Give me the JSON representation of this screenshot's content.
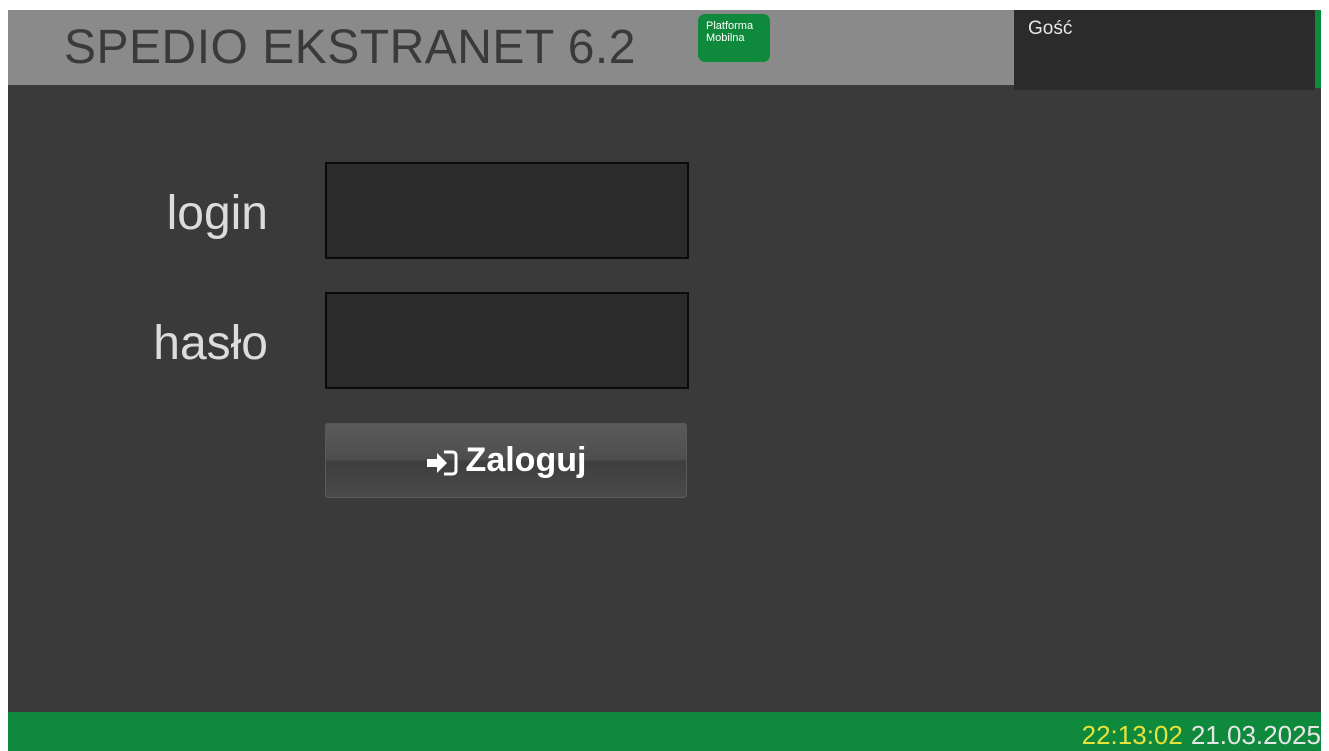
{
  "header": {
    "title": "SPEDIO EKSTRANET 6.2",
    "badge_line1": "Platforma",
    "badge_line2": "Mobilna",
    "user": "Gość"
  },
  "login_form": {
    "login_label": "login",
    "login_value": "",
    "password_label": "hasło",
    "password_value": "",
    "submit_label": "Zaloguj",
    "submit_icon": "sign-in-icon"
  },
  "footer": {
    "time": "22:13:02",
    "date": "21.03.2025"
  },
  "colors": {
    "header_bg": "#8a8a8a",
    "page_bg": "#3a3a3a",
    "accent_green": "#0f8a3c",
    "clock_time": "#e8e23a"
  }
}
